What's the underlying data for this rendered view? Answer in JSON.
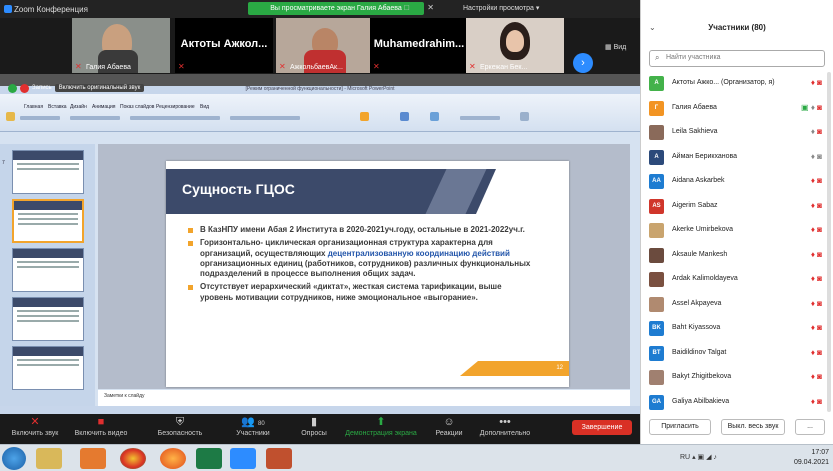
{
  "window": {
    "title": "Zoom Конференция",
    "banner": "Вы просматриваете экран Галия Абаева",
    "view_options": "Настройки просмотра",
    "view_label": "Вид"
  },
  "thumbnails": [
    {
      "name": "Галия Абаева",
      "kind": "video"
    },
    {
      "name": "Актоты Ажкол...",
      "kind": "name"
    },
    {
      "name": "АжкольбаевАк...",
      "kind": "video"
    },
    {
      "name": "Muhamedrahim...",
      "kind": "name"
    },
    {
      "name": "Еркежан Бек...",
      "kind": "video"
    }
  ],
  "share_bar": {
    "label": "Запись",
    "audio_label": "Включить оригинальный звук"
  },
  "powerpoint": {
    "title": "[Режим ограниченной функциональности] - Microsoft PowerPoint",
    "tabs": [
      "Главная",
      "Вставка",
      "Дизайн",
      "Анимация",
      "Показ слайдов",
      "Рецензирование",
      "Вид"
    ],
    "notes": "Заметки к слайду",
    "slides_count": 6,
    "slide": {
      "title": "Сущность ГЦОС",
      "bullets": [
        {
          "text": "В КазНПУ имени Абая 2 Института в 2020-2021уч.году, остальные в 2021-2022уч.г."
        },
        {
          "pre": "Горизонтально- циклическая  организационная структура характерна для организаций, осуществляющих ",
          "highlight": "децентрализованную координацию действий",
          "post": " организационных единиц (работников, сотрудников) различных функциональных подразделений в процессе выполнения общих задач."
        },
        {
          "text": "Отсутствует иерархический «диктат», жесткая система тарификации, выше уровень мотивации сотрудников,  ниже эмоциональное «выгорание»."
        }
      ],
      "number": "12"
    }
  },
  "toolbar": {
    "mute": "Включить звук",
    "video": "Включить видео",
    "security": "Безопасность",
    "participants": "Участники",
    "participants_count": "80",
    "polls": "Опросы",
    "share": "Демонстрация экрана",
    "reactions": "Реакции",
    "more": "Дополнительно",
    "end": "Завершение"
  },
  "panel": {
    "title": "Участники (80)",
    "search_placeholder": "Найти участника",
    "participants": [
      {
        "initials": "A",
        "name": "Актоты Ажко...  (Организатор, я)",
        "color": "#43b24a",
        "icons": "red"
      },
      {
        "initials": "Г",
        "name": "Галия Абаева",
        "color": "#f29423",
        "icons": "share"
      },
      {
        "initials": "",
        "name": "Leila Sakhieva",
        "color": "#8a6a5a",
        "icons": "greymic-redcam"
      },
      {
        "initials": "A",
        "name": "Айман Берикханова",
        "color": "#2c4a7a",
        "icons": "grey"
      },
      {
        "initials": "AA",
        "name": "Aidana Askarbek",
        "color": "#1e7cd1",
        "icons": "red"
      },
      {
        "initials": "AS",
        "name": "Aigerim Sabaz",
        "color": "#d0362b",
        "icons": "red"
      },
      {
        "initials": "",
        "name": "Akerke Umirbekova",
        "color": "#c9a46e",
        "icons": "red"
      },
      {
        "initials": "",
        "name": "Aksaule Mankesh",
        "color": "#6b4b3e",
        "icons": "red"
      },
      {
        "initials": "",
        "name": "Ardak Kalimoldayeva",
        "color": "#7a5040",
        "icons": "red"
      },
      {
        "initials": "",
        "name": "Assel Akpayeva",
        "color": "#b08a70",
        "icons": "red"
      },
      {
        "initials": "BK",
        "name": "Baht Kiyassova",
        "color": "#1e7cd1",
        "icons": "red"
      },
      {
        "initials": "BT",
        "name": "Baidildinov Talgat",
        "color": "#1e7cd1",
        "icons": "red"
      },
      {
        "initials": "",
        "name": "Bakyt Zhigitbekova",
        "color": "#a08070",
        "icons": "red"
      },
      {
        "initials": "GA",
        "name": "Galiya Abilbakieva",
        "color": "#1e7cd1",
        "icons": "red"
      }
    ],
    "invite": "Пригласить",
    "mute_all": "Выкл. весь звук",
    "more": "..."
  },
  "taskbar": {
    "lang": "RU",
    "time": "17:07",
    "date": "09.04.2021"
  }
}
